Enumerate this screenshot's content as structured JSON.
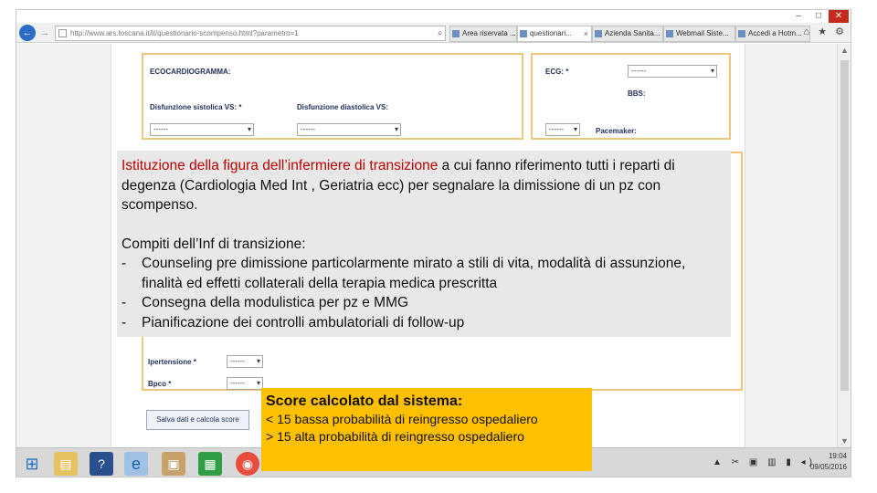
{
  "browser": {
    "address": "http://www.ars.toscana.it/it/questionario-scompenso.html?parametro=1",
    "tabs": [
      {
        "label": "Area riservata ..."
      },
      {
        "label": "questionari..."
      },
      {
        "label": "Azienda Sanita..."
      },
      {
        "label": "Webmail Siste..."
      },
      {
        "label": "Accedi a Hotm..."
      }
    ],
    "tab_close": "×",
    "window_controls": {
      "minimize": "–",
      "maximize": "□",
      "close": "✕"
    },
    "addr_tools": "⌕ ▾ ↻",
    "nav_icons": "⌂ ★ ⚙"
  },
  "form": {
    "section_title": "ECOCARDIOGRAMMA:",
    "disf_sistolica_label": "Disfunzione sistolica VS: *",
    "disf_diastolica_label": "Disfunzione diastolica VS:",
    "ecg_label": "ECG: *",
    "bbs_label": "BBS:",
    "pacemaker_label": "Pacemaker:",
    "ipertensione_label": "Ipertensione *",
    "bpco_label": "Bpco *",
    "select_placeholder": "------",
    "save_button": "Salva dati e calcola score"
  },
  "overlay": {
    "intro_red": "Istituzione della figura dell’infermiere di transizione",
    "intro_rest": " a cui fanno riferimento tutti i reparti di degenza (Cardiologia Med Int , Geriatria ecc) per segnalare la dimissione di un pz con scompenso.",
    "compiti_title": "Compiti dell’Inf di transizione:",
    "bullet_dash": "-",
    "bullets": [
      "Counseling pre dimissione particolarmente mirato a stili di vita, modalità di assunzione, finalità ed effetti collaterali della terapia medica prescritta",
      "Consegna della modulistica per pz e MMG",
      "Pianificazione dei controlli ambulatoriali di follow-up"
    ]
  },
  "score": {
    "title": "Score calcolato dal sistema:",
    "line1": "< 15 bassa probabilità di reingresso ospedaliero",
    "line2": "> 15 alta probabilità di reingresso ospedaliero"
  },
  "taskbar": {
    "time": "19:04",
    "date": "09/05/2016",
    "tray": "▲ ✂ ▣ ▥ ▮ ◂)"
  },
  "colors": {
    "highlight_red": "#c00000",
    "score_bg": "#ffc000",
    "panel_border": "#f0c77a"
  }
}
